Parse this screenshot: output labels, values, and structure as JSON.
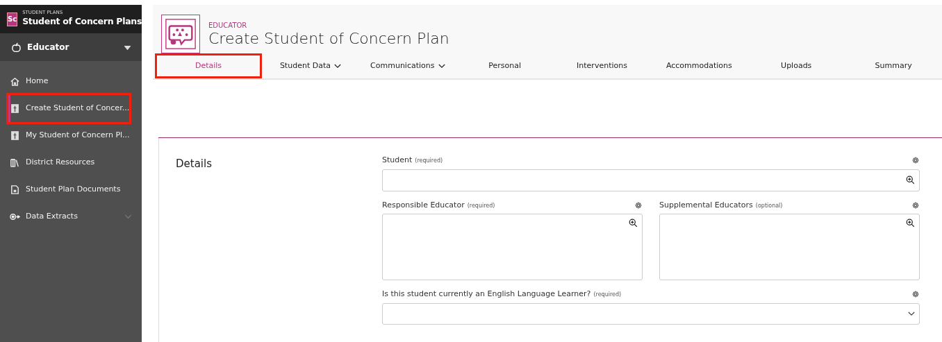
{
  "app": {
    "badge": "Sc",
    "caption": "STUDENT PLANS",
    "title": "Student of Concern Plans"
  },
  "role_menu": {
    "label": "Educator",
    "expanded": false
  },
  "sidebar": {
    "items": [
      {
        "label": "Home",
        "selected": false,
        "highlighted": false
      },
      {
        "label": "Create Student of Concer...",
        "selected": true,
        "highlighted": true
      },
      {
        "label": "My Student of Concern Pl...",
        "selected": false,
        "highlighted": false
      },
      {
        "label": "District Resources",
        "selected": false,
        "highlighted": false
      },
      {
        "label": "Student Plan Documents",
        "selected": false,
        "highlighted": false
      },
      {
        "label": "Data Extracts",
        "selected": false,
        "highlighted": false,
        "expandable": true
      }
    ]
  },
  "page": {
    "caption": "EDUCATOR",
    "title": "Create Student of Concern Plan"
  },
  "tabs": [
    {
      "label": "Details",
      "selected": true,
      "highlighted": true,
      "dropdown": false
    },
    {
      "label": "Student Data",
      "selected": false,
      "highlighted": false,
      "dropdown": true
    },
    {
      "label": "Communications",
      "selected": false,
      "highlighted": false,
      "dropdown": true
    },
    {
      "label": "Personal",
      "selected": false,
      "highlighted": false,
      "dropdown": false
    },
    {
      "label": "Interventions",
      "selected": false,
      "highlighted": false,
      "dropdown": false
    },
    {
      "label": "Accommodations",
      "selected": false,
      "highlighted": false,
      "dropdown": false
    },
    {
      "label": "Uploads",
      "selected": false,
      "highlighted": false,
      "dropdown": false
    },
    {
      "label": "Summary",
      "selected": false,
      "highlighted": false,
      "dropdown": false
    }
  ],
  "section": {
    "title": "Details",
    "rows": [
      [
        {
          "label": "Student",
          "note": "(required)",
          "kind": "lookup"
        }
      ],
      [
        {
          "label": "Responsible Educator",
          "note": "(required)",
          "kind": "multi"
        },
        {
          "label": "Supplemental Educators",
          "note": "(optional)",
          "kind": "multi"
        }
      ],
      [
        {
          "label": "Is this student currently an English Language Learner?",
          "note": "(required)",
          "kind": "select"
        }
      ]
    ]
  }
}
